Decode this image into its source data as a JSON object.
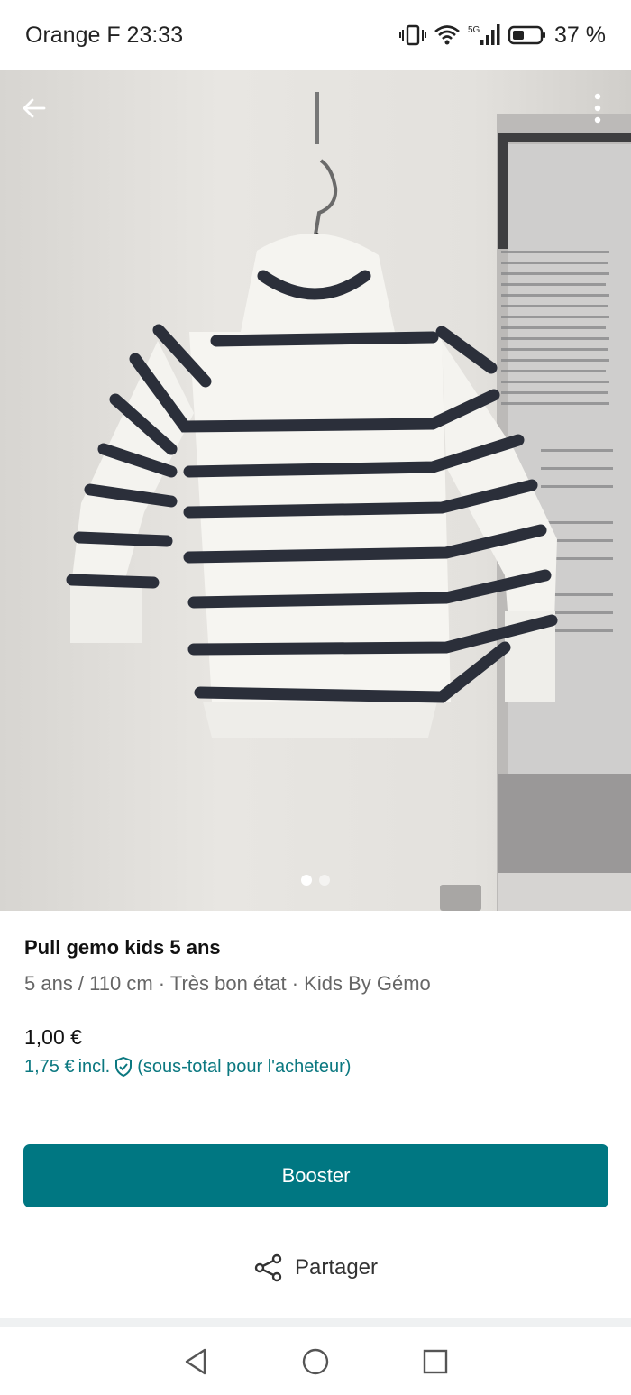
{
  "status_bar": {
    "left_text": "Orange F 23:33",
    "network": "5G",
    "battery_text": "37 %"
  },
  "photo": {
    "page_count": 2,
    "active_page": 1,
    "icons": [
      "arrow-left-icon",
      "more-vertical-icon"
    ]
  },
  "listing": {
    "title": "Pull gemo kids 5 ans",
    "details": "5 ans / 110 cm · Très bon état · Kids By Gémo",
    "price": "1,00 €",
    "price_with_fee": "1,75 €",
    "fee_incl": "incl.",
    "fee_note": "(sous-total pour l'acheteur)"
  },
  "actions": {
    "booster_label": "Booster",
    "share_label": "Partager"
  },
  "colors": {
    "accent": "#007782",
    "fee_text": "#0b7880"
  }
}
